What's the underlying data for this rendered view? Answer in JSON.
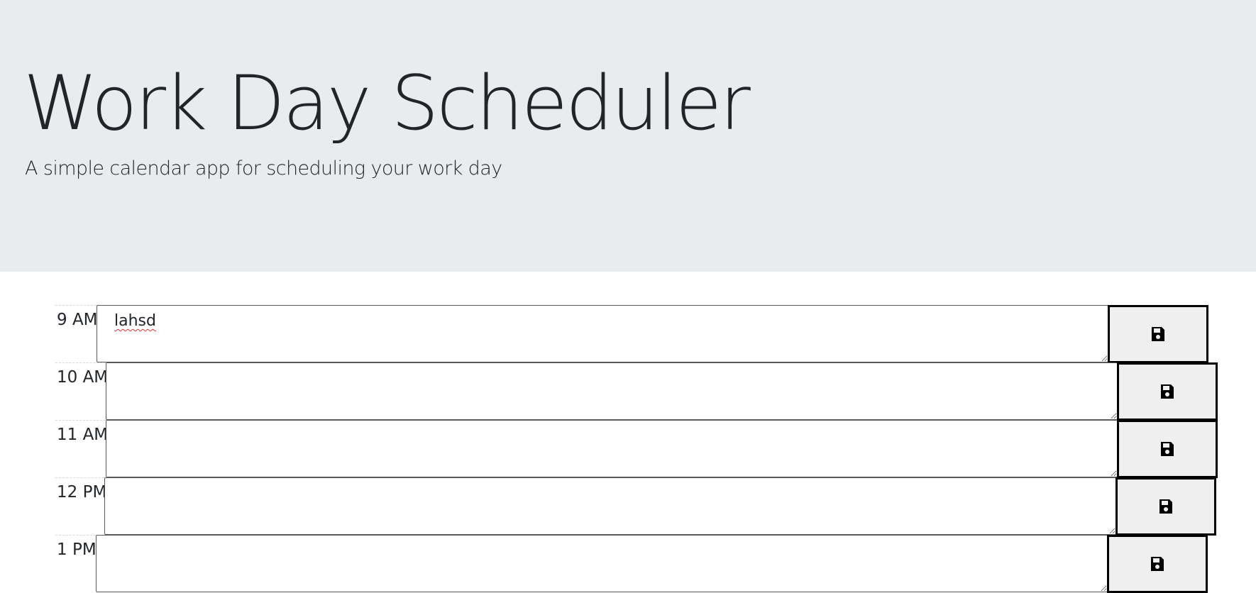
{
  "header": {
    "title": "Work Day Scheduler",
    "subtitle": "A simple calendar app for scheduling your work day"
  },
  "schedule": {
    "rows": [
      {
        "hour": "9 AM",
        "description": "lahsd",
        "save_icon": "floppy-disk-icon"
      },
      {
        "hour": "10 AM",
        "description": "",
        "save_icon": "floppy-disk-icon"
      },
      {
        "hour": "11 AM",
        "description": "",
        "save_icon": "floppy-disk-icon"
      },
      {
        "hour": "12 PM",
        "description": "",
        "save_icon": "floppy-disk-icon"
      },
      {
        "hour": "1 PM",
        "description": "",
        "save_icon": "floppy-disk-icon"
      }
    ]
  },
  "colors": {
    "jumbotron_bg": "#e9ecef",
    "button_bg": "#efefef",
    "text": "#212529"
  }
}
